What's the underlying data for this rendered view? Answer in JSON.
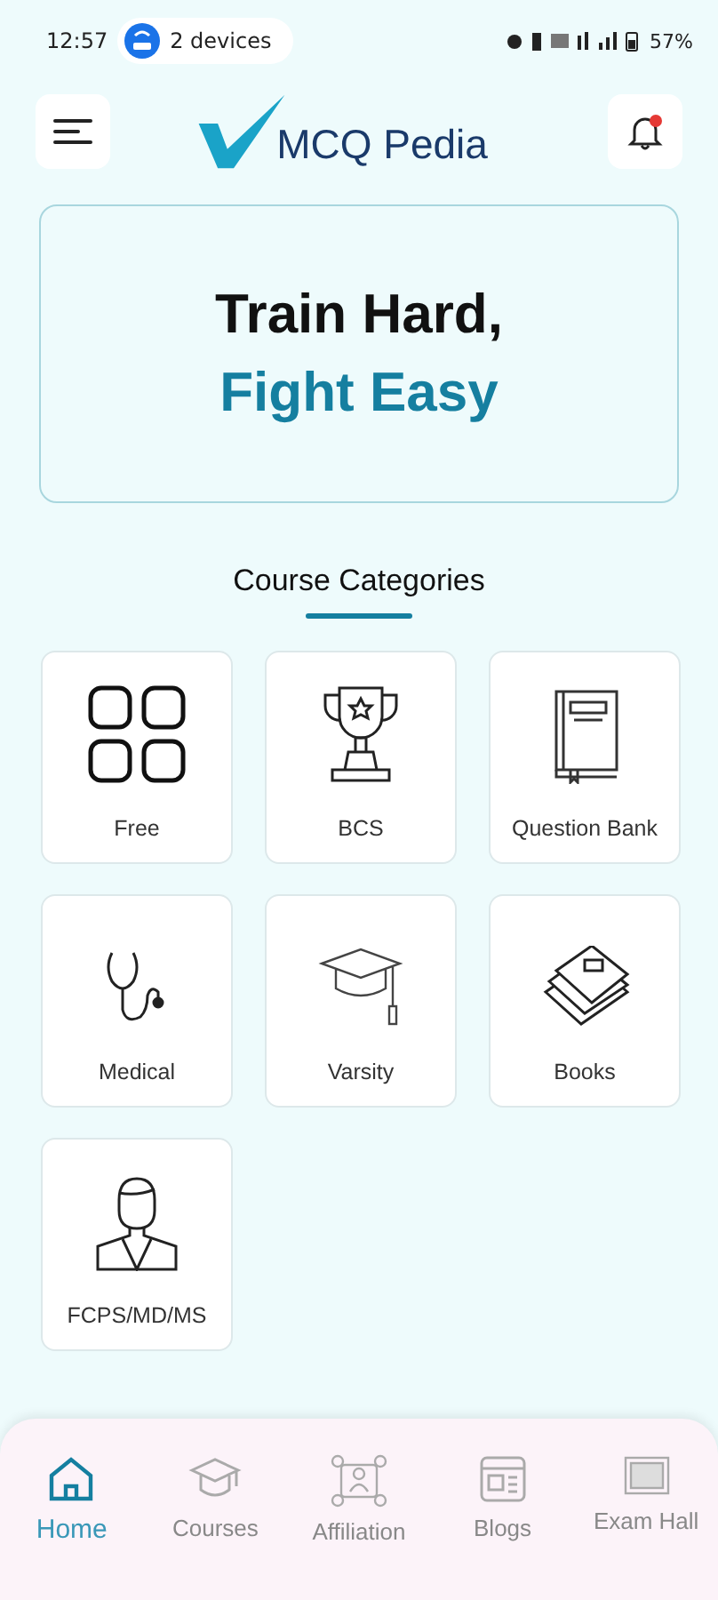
{
  "status_bar": {
    "time": "12:57",
    "devices": "2 devices",
    "battery": "57%"
  },
  "header": {
    "logo_text": "MCQ Pedia",
    "notification_unread": true
  },
  "hero": {
    "line_1": "Train Hard,",
    "line_2": "Fight Easy"
  },
  "categories_title": "Course Categories",
  "categories": [
    {
      "kind": "grid",
      "label": "Free"
    },
    {
      "kind": "trophy",
      "label": "BCS"
    },
    {
      "kind": "book",
      "label": "Question Bank"
    },
    {
      "kind": "stethoscope",
      "label": "Medical"
    },
    {
      "kind": "cap",
      "label": "Varsity"
    },
    {
      "kind": "books",
      "label": "Books"
    },
    {
      "kind": "doctor",
      "label": "FCPS/MD/MS"
    }
  ],
  "nav": [
    {
      "kind": "home",
      "label": "Home",
      "selected": true
    },
    {
      "kind": "courses",
      "label": "Courses",
      "selected": false
    },
    {
      "kind": "affiliation",
      "label": "Affiliation",
      "selected": false
    },
    {
      "kind": "blogs",
      "label": "Blogs",
      "selected": false
    },
    {
      "kind": "exam",
      "label": "Exam Hall",
      "selected": false
    }
  ]
}
